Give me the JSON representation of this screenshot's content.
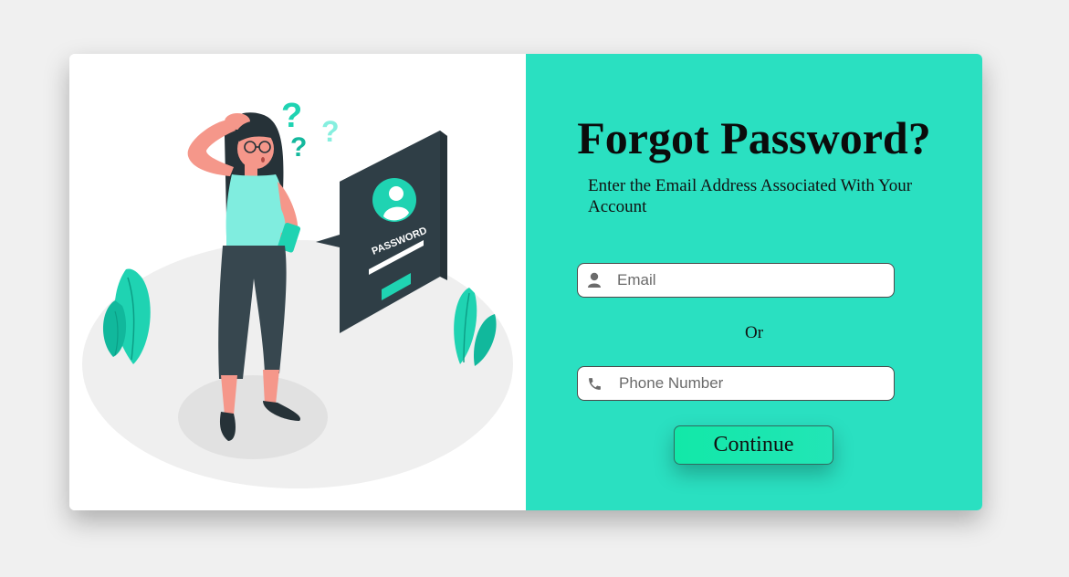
{
  "form": {
    "title": "Forgot Password?",
    "subtitle": "Enter the Email Address Associated With Your Account",
    "email_placeholder": "Email",
    "or_label": "Or",
    "phone_placeholder": "Phone Number",
    "continue_label": "Continue"
  },
  "illustration": {
    "password_label": "PASSWORD"
  },
  "icons": {
    "email": "user-icon",
    "phone": "phone-icon"
  },
  "colors": {
    "panel": "#2ae0c1",
    "accent": "#14d9b4",
    "button": "#12e8a8",
    "page_background": "#f0f0f0"
  }
}
